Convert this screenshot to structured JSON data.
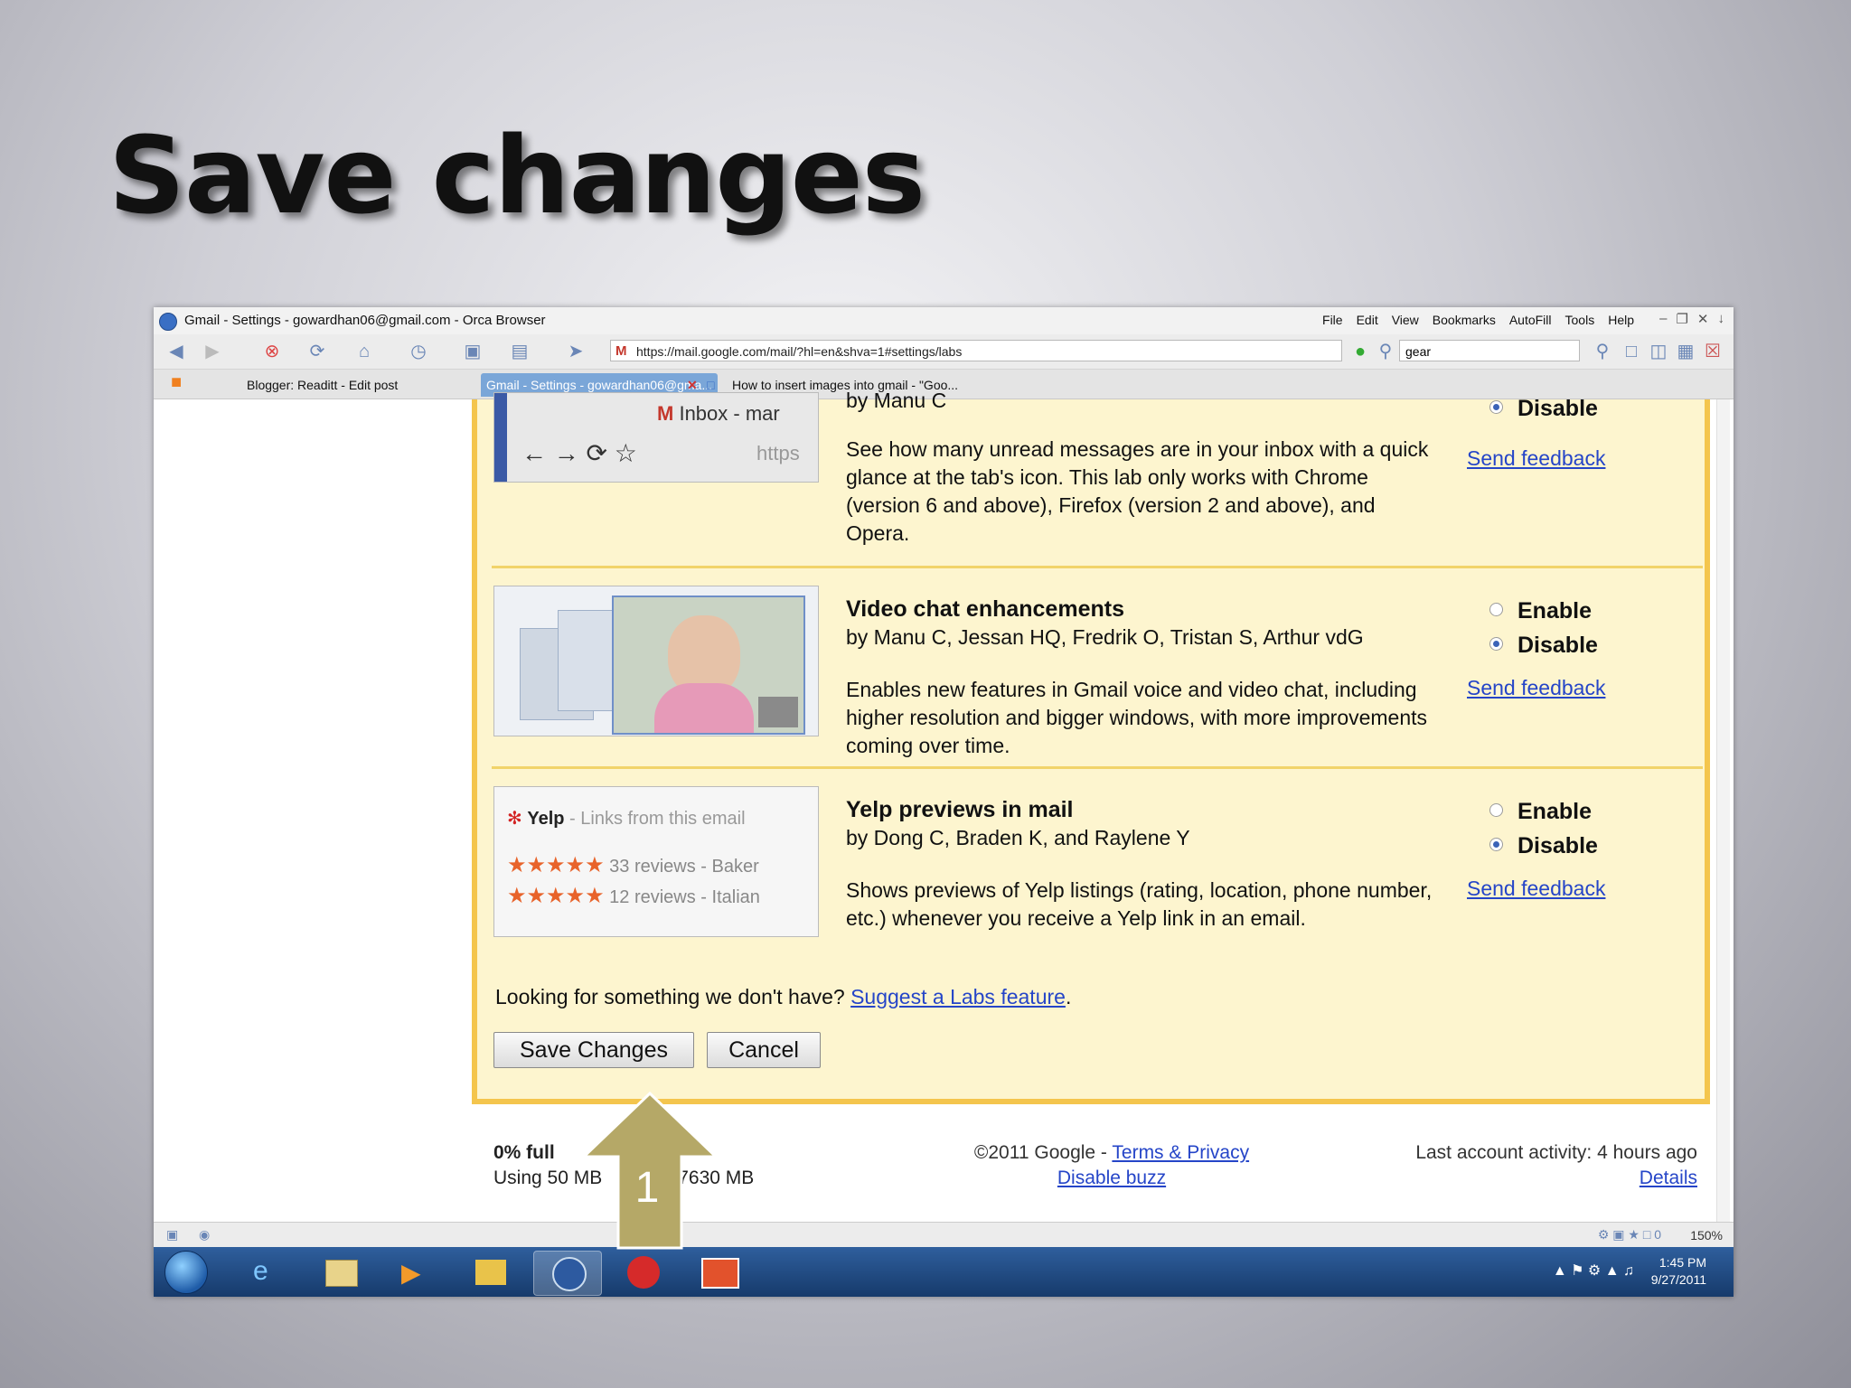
{
  "slide": {
    "title": "Save changes",
    "step_number": "1"
  },
  "browser": {
    "window_title": "Gmail - Settings - gowardhan06@gmail.com - Orca Browser",
    "menu": [
      "File",
      "Edit",
      "View",
      "Bookmarks",
      "AutoFill",
      "Tools",
      "Help"
    ],
    "url": "https://mail.google.com/mail/?hl=en&shva=1#settings/labs",
    "search_value": "gear",
    "tabs": [
      {
        "label": "Blogger: Readitt - Edit post",
        "active": false
      },
      {
        "label": "Gmail - Settings - gowardhan06@gma...",
        "active": true
      },
      {
        "label": "How to insert images into gmail - \"Goo...",
        "active": false
      }
    ],
    "zoom": "150%"
  },
  "labs": {
    "partial": {
      "authors": "by Manu C",
      "description": "See how many unread messages are in your inbox with a quick glance at the tab's icon. This lab only works with Chrome (version 6 and above), Firefox (version 2 and above), and Opera.",
      "disable_label": "Disable",
      "feedback": "Send feedback",
      "thumb_text": "Inbox - mar",
      "thumb_url": "https"
    },
    "items": [
      {
        "title": "Video chat enhancements",
        "authors": "by Manu C, Jessan HQ, Fredrik O, Tristan S, Arthur vdG",
        "description": "Enables new features in Gmail voice and video chat, including higher resolution and bigger windows, with more improvements coming over time.",
        "enable_label": "Enable",
        "disable_label": "Disable",
        "selected": "Disable",
        "feedback": "Send feedback"
      },
      {
        "title": "Yelp previews in mail",
        "authors": "by Dong C, Braden K, and Raylene Y",
        "description": "Shows previews of Yelp listings (rating, location, phone number, etc.) whenever you receive a Yelp link in an email.",
        "enable_label": "Enable",
        "disable_label": "Disable",
        "selected": "Disable",
        "feedback": "Send feedback",
        "thumb_brand": "Yelp",
        "thumb_sub": "- Links from this email",
        "thumb_row1": "33 reviews - Baker",
        "thumb_row2": "12 reviews - Italian"
      }
    ],
    "looking_text": "Looking for something we don't have?",
    "suggest_link": "Suggest a Labs feature",
    "save_label": "Save Changes",
    "cancel_label": "Cancel"
  },
  "footer": {
    "usage_pct": "0% full",
    "usage_left": "Using 50 MB",
    "usage_right": "7630 MB",
    "copyright": "©2011 Google -",
    "terms": "Terms & Privacy",
    "disable_buzz": "Disable buzz",
    "activity": "Last account activity: 4 hours ago",
    "details": "Details"
  },
  "taskbar": {
    "time": "1:45 PM",
    "date": "9/27/2011"
  },
  "colors": {
    "labs_bg": "#fdf5cf",
    "labs_border": "#f4c54d",
    "link": "#2545c8",
    "arrow": "#b5a867"
  }
}
